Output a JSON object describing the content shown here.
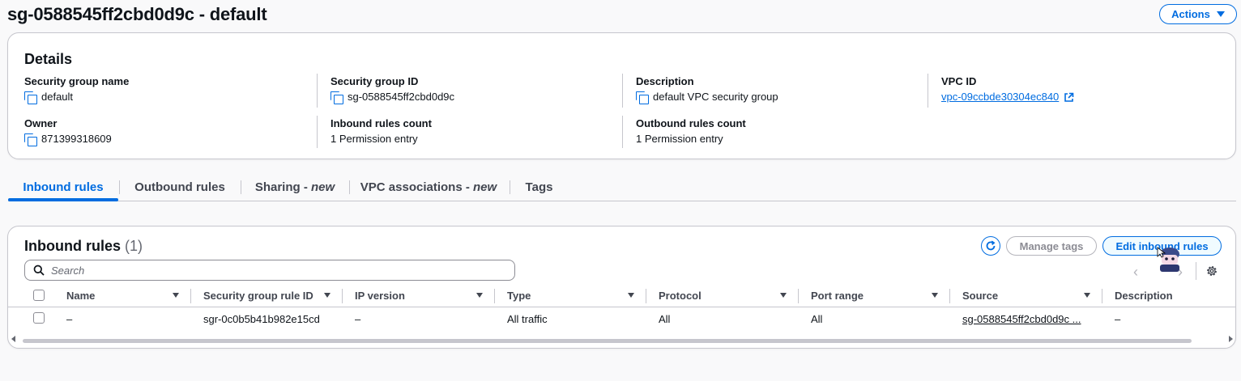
{
  "page": {
    "title": "sg-0588545ff2cbd0d9c - default",
    "actions_label": "Actions"
  },
  "details": {
    "title": "Details",
    "fields": {
      "sg_name": {
        "label": "Security group name",
        "value": "default"
      },
      "sg_id": {
        "label": "Security group ID",
        "value": "sg-0588545ff2cbd0d9c"
      },
      "description": {
        "label": "Description",
        "value": "default VPC security group"
      },
      "vpc_id": {
        "label": "VPC ID",
        "value": "vpc-09ccbde30304ec840"
      },
      "owner": {
        "label": "Owner",
        "value": "871399318609"
      },
      "inbound_count": {
        "label": "Inbound rules count",
        "value": "1 Permission entry"
      },
      "outbound_count": {
        "label": "Outbound rules count",
        "value": "1 Permission entry"
      }
    }
  },
  "tabs": [
    {
      "label": "Inbound rules",
      "suffix": "",
      "active": true
    },
    {
      "label": "Outbound rules",
      "suffix": "",
      "active": false
    },
    {
      "label": "Sharing - ",
      "suffix": "new",
      "active": false
    },
    {
      "label": "VPC associations - ",
      "suffix": "new",
      "active": false
    },
    {
      "label": "Tags",
      "suffix": "",
      "active": false
    }
  ],
  "inbound": {
    "title": "Inbound rules",
    "count": "(1)",
    "manage_tags_label": "Manage tags",
    "edit_label": "Edit inbound rules",
    "search_placeholder": "Search",
    "columns": [
      "Name",
      "Security group rule ID",
      "IP version",
      "Type",
      "Protocol",
      "Port range",
      "Source",
      "Description"
    ],
    "rows": [
      {
        "name": "–",
        "rule_id": "sgr-0c0b5b41b982e15cd",
        "ip_version": "–",
        "type": "All traffic",
        "protocol": "All",
        "port_range": "All",
        "source": "sg-0588545ff2cbd0d9c ...",
        "description": "–"
      }
    ]
  },
  "colors": {
    "accent": "#006ce0",
    "border": "#c6c6cd",
    "text": "#0f141a",
    "muted": "#656871"
  }
}
